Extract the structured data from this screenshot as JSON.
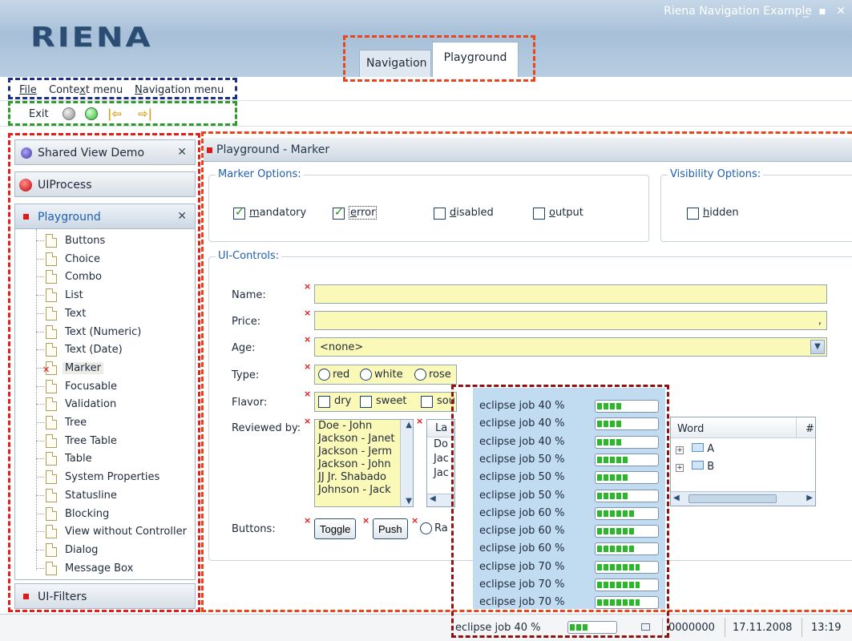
{
  "window": {
    "title": "Riena Navigation Example",
    "controls": "_ ▪ ✕"
  },
  "logo": "RIENA",
  "top_tabs": [
    {
      "label": "Navigation",
      "active": false
    },
    {
      "label": "Playground",
      "active": true
    }
  ],
  "menu": {
    "file": "File",
    "context_pre": "Conte",
    "context_key": "x",
    "context_post": "t menu",
    "navigation_key": "N",
    "navigation_post": "avigation menu"
  },
  "toolbar": {
    "exit": "Exit",
    "back_glyph": "|⇦",
    "forward_glyph": "⇨|"
  },
  "nav": {
    "groups": [
      {
        "label": "Shared View Demo",
        "icon": "globe-icon",
        "closable": true
      },
      {
        "label": "UIProcess",
        "icon": "red-ball-icon",
        "closable": false
      },
      {
        "label": "Playground",
        "icon": "red-square-icon",
        "closable": true
      },
      {
        "label": "UI-Filters",
        "icon": "red-square-icon",
        "closable": false
      }
    ],
    "close_glyph": "✕",
    "items": [
      "Buttons",
      "Choice",
      "Combo",
      "List",
      "Text",
      "Text (Numeric)",
      "Text (Date)",
      "Marker",
      "Focusable",
      "Validation",
      "Tree",
      "Tree Table",
      "Table",
      "System Properties",
      "Statusline",
      "Blocking",
      "View without Controller",
      "Dialog",
      "Message Box"
    ],
    "selected_item": "Marker"
  },
  "main": {
    "title": "Playground - Marker",
    "marker_options": {
      "title": "Marker Options:",
      "mandatory_pre": "",
      "mandatory_key": "m",
      "mandatory_post": "andatory",
      "error_key": "e",
      "error_post": "rror",
      "disabled_key": "d",
      "disabled_post": "isabled",
      "output_key": "o",
      "output_post": "utput",
      "mandatory_checked": true,
      "error_checked": true,
      "disabled_checked": false,
      "output_checked": false
    },
    "visibility_options": {
      "title": "Visibility Options:",
      "hidden_key": "h",
      "hidden_post": "idden",
      "hidden_checked": false
    },
    "ui_controls": {
      "title": "UI-Controls:",
      "name_label": "Name:",
      "name_value": "",
      "price_label": "Price:",
      "price_value": ",",
      "age_label": "Age:",
      "age_value": "<none>",
      "type_label": "Type:",
      "type_options": [
        "red",
        "white",
        "rose"
      ],
      "flavor_label": "Flavor:",
      "flavor_options": [
        "dry",
        "sweet",
        "sou"
      ],
      "reviewed_label": "Reviewed by:",
      "reviewers": [
        "Doe - John",
        "Jackson - Janet",
        "Jackson - Jerm",
        "Jackson - John",
        "JJ Jr. Shabado",
        "Johnson - Jack"
      ],
      "table_header": "La",
      "table_rows": [
        "Do",
        "Jac",
        "Jac"
      ],
      "buttons_label": "Buttons:",
      "toggle": "Toggle",
      "push": "Push",
      "radio_label": "Ra",
      "tree_table": {
        "header_word": "Word",
        "header_num": "#",
        "rows": [
          "A",
          "B"
        ]
      },
      "required_glyph": "×"
    }
  },
  "jobs": {
    "popup": [
      {
        "label": "eclipse job 40 %",
        "progress": 0.4
      },
      {
        "label": "eclipse job 40 %",
        "progress": 0.4
      },
      {
        "label": "eclipse job 40 %",
        "progress": 0.4
      },
      {
        "label": "eclipse job 50 %",
        "progress": 0.5
      },
      {
        "label": "eclipse job 50 %",
        "progress": 0.5
      },
      {
        "label": "eclipse job 50 %",
        "progress": 0.5
      },
      {
        "label": "eclipse job 60 %",
        "progress": 0.6
      },
      {
        "label": "eclipse job 60 %",
        "progress": 0.6
      },
      {
        "label": "eclipse job 60 %",
        "progress": 0.6
      },
      {
        "label": "eclipse job 70 %",
        "progress": 0.7
      },
      {
        "label": "eclipse job 70 %",
        "progress": 0.7
      },
      {
        "label": "eclipse job 70 %",
        "progress": 0.7
      }
    ]
  },
  "status": {
    "job_label": "eclipse job 40 %",
    "job_progress": 0.4,
    "number": "0000000",
    "date": "17.11.2008",
    "time": "13:19"
  },
  "colors": {
    "accent": "#1f5fb0",
    "mandatory_bg": "#fbf9b7",
    "marker_red": "#e01818",
    "progress_green": "#28b828"
  }
}
